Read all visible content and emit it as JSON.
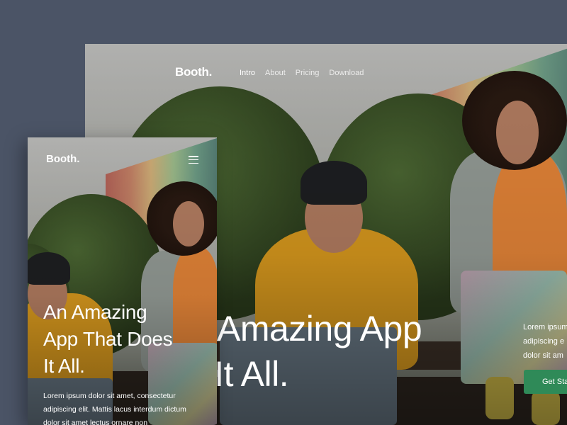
{
  "desktop": {
    "logo": "Booth.",
    "nav": [
      {
        "label": "Intro",
        "active": true
      },
      {
        "label": "About",
        "active": false
      },
      {
        "label": "Pricing",
        "active": false
      },
      {
        "label": "Download",
        "active": false
      }
    ],
    "headline_line1": "Amazing App",
    "headline_line2": "at Does It All.",
    "lorem_line1": "Lorem ipsum",
    "lorem_line2": "adipiscing e",
    "lorem_line3": "dolor sit am",
    "cta_label": "Get Sta"
  },
  "mobile": {
    "logo": "Booth.",
    "menu_icon": "hamburger-icon",
    "headline_line1": "An Amazing",
    "headline_line2": "App That Does",
    "headline_line3": "It All.",
    "lorem_line1": "Lorem ipsum dolor sit amet, consectetur",
    "lorem_line2": "adipiscing elit. Mattis lacus interdum dictum",
    "lorem_line3": "dolor sit amet lectus ornare non"
  },
  "colors": {
    "background": "#4b5466",
    "cta": "#2f8a58",
    "text": "#ffffff"
  }
}
